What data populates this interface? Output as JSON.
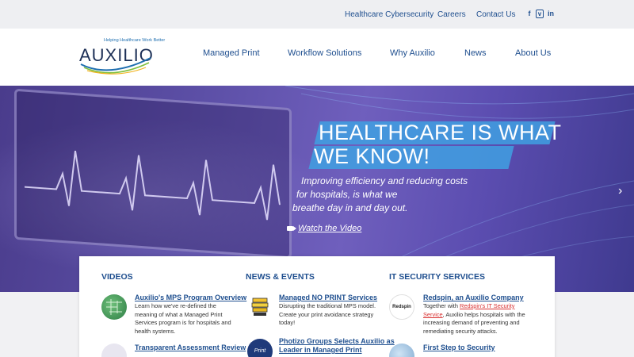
{
  "topbar": {
    "links": [
      "Healthcare Cybersecurity",
      "Careers",
      "Contact Us"
    ],
    "social": [
      {
        "name": "facebook-icon",
        "glyph": "f"
      },
      {
        "name": "vimeo-icon",
        "glyph": "v"
      },
      {
        "name": "linkedin-icon",
        "glyph": "in"
      }
    ]
  },
  "header": {
    "tagline": "Helping Healthcare Work Better",
    "brand": "AUXILIO",
    "nav": [
      "Managed Print",
      "Workflow Solutions",
      "Why Auxilio",
      "News",
      "About Us"
    ]
  },
  "hero": {
    "headline_line1": "HEALTHCARE IS WHAT",
    "headline_line2": "WE KNOW!",
    "subcopy_line1": "Improving efficiency and reducing costs",
    "subcopy_line2": "for hospitals, is what we",
    "subcopy_line3": "breathe day in and day out.",
    "watch_label": "Watch the Video",
    "next_arrow": "›"
  },
  "panel": {
    "videos": {
      "title": "VIDEOS",
      "items": [
        {
          "title": "Auxilio's MPS Program Overview",
          "desc": "Learn how we've re-defined the meaning of what a Managed Print Services program is for hospitals and health systems."
        },
        {
          "title": "Transparent Assessment Review",
          "desc": ""
        }
      ]
    },
    "news": {
      "title": "NEWS & EVENTS",
      "items": [
        {
          "title": "Managed NO PRINT Services",
          "desc": "Disrupting the traditional MPS model. Create your print avoidance strategy today!"
        },
        {
          "title_line1": "Photizo Groups Selects Auxilio as",
          "title_line2": "Leader in Managed Print",
          "icon_text": "Print"
        }
      ]
    },
    "security": {
      "title": "IT SECURITY SERVICES",
      "items": [
        {
          "title": "Redspin, an Auxilio Company",
          "desc_before": "Together with ",
          "desc_link": "Redspin's IT Security Service",
          "desc_after": ", Auxilio helps hospitals with the increasing demand of preventing and remediating security attacks.",
          "icon_text": "Redspin"
        },
        {
          "title": "First Step to Security",
          "desc": ""
        }
      ]
    }
  },
  "colors": {
    "brand_blue": "#1f4f8f",
    "hero_purple": "#5c4fa6",
    "headline_bar": "#40a0e2",
    "link_red": "#d93030"
  }
}
